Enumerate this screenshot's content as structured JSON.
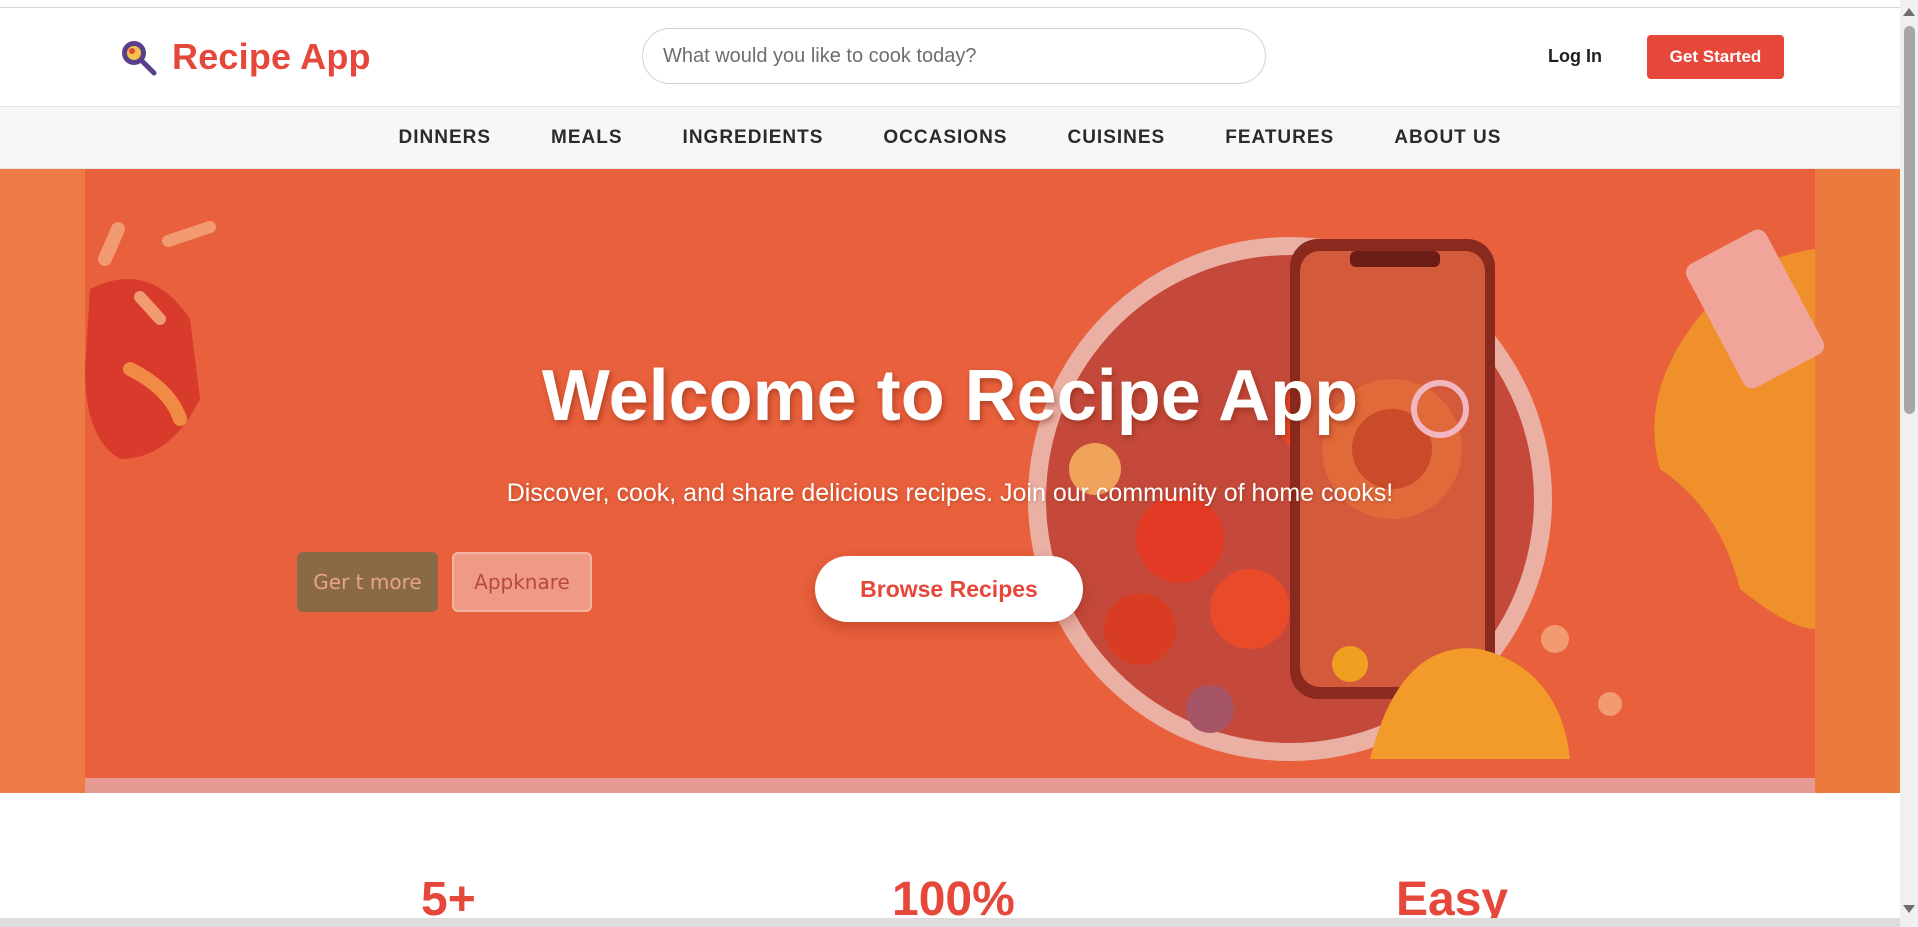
{
  "header": {
    "app_name": "Recipe App",
    "search_placeholder": "What would you like to cook today?",
    "login_label": "Log In",
    "get_started_label": "Get Started"
  },
  "nav": {
    "items": [
      "DINNERS",
      "MEALS",
      "INGREDIENTS",
      "OCCASIONS",
      "CUISINES",
      "FEATURES",
      "ABOUT US"
    ]
  },
  "hero": {
    "title": "Welcome to Recipe App",
    "subtitle": "Discover, cook, and share delicious recipes. Join our community of home cooks!",
    "cta_label": "Browse Recipes",
    "art_button_1": "Ger t more",
    "art_button_2": "Appknare"
  },
  "stats": [
    "5+",
    "100%",
    "Easy"
  ],
  "colors": {
    "brand": "#e5473b",
    "hero_background": "#e8603c",
    "logo_icon": "#5b3f8a"
  },
  "icons": [
    "logo-magnifier-icon",
    "scroll-up-arrow-icon",
    "scroll-down-arrow-icon"
  ]
}
